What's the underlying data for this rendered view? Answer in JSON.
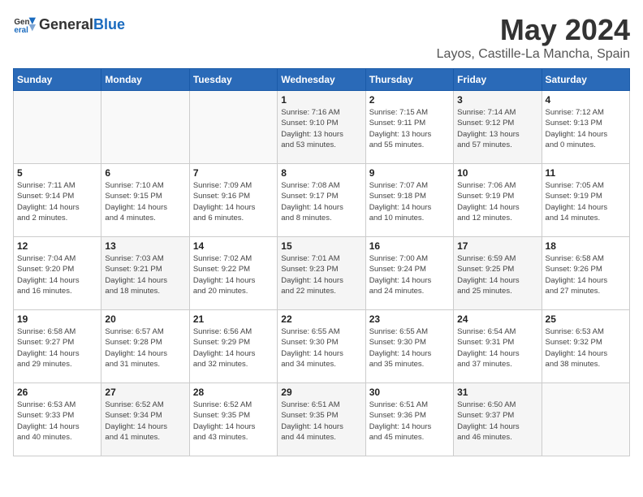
{
  "header": {
    "logo_general": "General",
    "logo_blue": "Blue",
    "title": "May 2024",
    "subtitle": "Layos, Castille-La Mancha, Spain"
  },
  "weekdays": [
    "Sunday",
    "Monday",
    "Tuesday",
    "Wednesday",
    "Thursday",
    "Friday",
    "Saturday"
  ],
  "weeks": [
    [
      {
        "day": "",
        "info": ""
      },
      {
        "day": "",
        "info": ""
      },
      {
        "day": "",
        "info": ""
      },
      {
        "day": "1",
        "info": "Sunrise: 7:16 AM\nSunset: 9:10 PM\nDaylight: 13 hours\nand 53 minutes."
      },
      {
        "day": "2",
        "info": "Sunrise: 7:15 AM\nSunset: 9:11 PM\nDaylight: 13 hours\nand 55 minutes."
      },
      {
        "day": "3",
        "info": "Sunrise: 7:14 AM\nSunset: 9:12 PM\nDaylight: 13 hours\nand 57 minutes."
      },
      {
        "day": "4",
        "info": "Sunrise: 7:12 AM\nSunset: 9:13 PM\nDaylight: 14 hours\nand 0 minutes."
      }
    ],
    [
      {
        "day": "5",
        "info": "Sunrise: 7:11 AM\nSunset: 9:14 PM\nDaylight: 14 hours\nand 2 minutes."
      },
      {
        "day": "6",
        "info": "Sunrise: 7:10 AM\nSunset: 9:15 PM\nDaylight: 14 hours\nand 4 minutes."
      },
      {
        "day": "7",
        "info": "Sunrise: 7:09 AM\nSunset: 9:16 PM\nDaylight: 14 hours\nand 6 minutes."
      },
      {
        "day": "8",
        "info": "Sunrise: 7:08 AM\nSunset: 9:17 PM\nDaylight: 14 hours\nand 8 minutes."
      },
      {
        "day": "9",
        "info": "Sunrise: 7:07 AM\nSunset: 9:18 PM\nDaylight: 14 hours\nand 10 minutes."
      },
      {
        "day": "10",
        "info": "Sunrise: 7:06 AM\nSunset: 9:19 PM\nDaylight: 14 hours\nand 12 minutes."
      },
      {
        "day": "11",
        "info": "Sunrise: 7:05 AM\nSunset: 9:19 PM\nDaylight: 14 hours\nand 14 minutes."
      }
    ],
    [
      {
        "day": "12",
        "info": "Sunrise: 7:04 AM\nSunset: 9:20 PM\nDaylight: 14 hours\nand 16 minutes."
      },
      {
        "day": "13",
        "info": "Sunrise: 7:03 AM\nSunset: 9:21 PM\nDaylight: 14 hours\nand 18 minutes."
      },
      {
        "day": "14",
        "info": "Sunrise: 7:02 AM\nSunset: 9:22 PM\nDaylight: 14 hours\nand 20 minutes."
      },
      {
        "day": "15",
        "info": "Sunrise: 7:01 AM\nSunset: 9:23 PM\nDaylight: 14 hours\nand 22 minutes."
      },
      {
        "day": "16",
        "info": "Sunrise: 7:00 AM\nSunset: 9:24 PM\nDaylight: 14 hours\nand 24 minutes."
      },
      {
        "day": "17",
        "info": "Sunrise: 6:59 AM\nSunset: 9:25 PM\nDaylight: 14 hours\nand 25 minutes."
      },
      {
        "day": "18",
        "info": "Sunrise: 6:58 AM\nSunset: 9:26 PM\nDaylight: 14 hours\nand 27 minutes."
      }
    ],
    [
      {
        "day": "19",
        "info": "Sunrise: 6:58 AM\nSunset: 9:27 PM\nDaylight: 14 hours\nand 29 minutes."
      },
      {
        "day": "20",
        "info": "Sunrise: 6:57 AM\nSunset: 9:28 PM\nDaylight: 14 hours\nand 31 minutes."
      },
      {
        "day": "21",
        "info": "Sunrise: 6:56 AM\nSunset: 9:29 PM\nDaylight: 14 hours\nand 32 minutes."
      },
      {
        "day": "22",
        "info": "Sunrise: 6:55 AM\nSunset: 9:30 PM\nDaylight: 14 hours\nand 34 minutes."
      },
      {
        "day": "23",
        "info": "Sunrise: 6:55 AM\nSunset: 9:30 PM\nDaylight: 14 hours\nand 35 minutes."
      },
      {
        "day": "24",
        "info": "Sunrise: 6:54 AM\nSunset: 9:31 PM\nDaylight: 14 hours\nand 37 minutes."
      },
      {
        "day": "25",
        "info": "Sunrise: 6:53 AM\nSunset: 9:32 PM\nDaylight: 14 hours\nand 38 minutes."
      }
    ],
    [
      {
        "day": "26",
        "info": "Sunrise: 6:53 AM\nSunset: 9:33 PM\nDaylight: 14 hours\nand 40 minutes."
      },
      {
        "day": "27",
        "info": "Sunrise: 6:52 AM\nSunset: 9:34 PM\nDaylight: 14 hours\nand 41 minutes."
      },
      {
        "day": "28",
        "info": "Sunrise: 6:52 AM\nSunset: 9:35 PM\nDaylight: 14 hours\nand 43 minutes."
      },
      {
        "day": "29",
        "info": "Sunrise: 6:51 AM\nSunset: 9:35 PM\nDaylight: 14 hours\nand 44 minutes."
      },
      {
        "day": "30",
        "info": "Sunrise: 6:51 AM\nSunset: 9:36 PM\nDaylight: 14 hours\nand 45 minutes."
      },
      {
        "day": "31",
        "info": "Sunrise: 6:50 AM\nSunset: 9:37 PM\nDaylight: 14 hours\nand 46 minutes."
      },
      {
        "day": "",
        "info": ""
      }
    ]
  ]
}
